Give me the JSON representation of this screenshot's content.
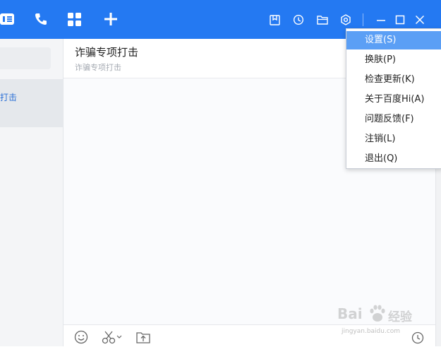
{
  "colors": {
    "accent": "#2479f2",
    "menu_highlight": "#5b9ff5",
    "link": "#2a6fd6"
  },
  "topbar": {
    "left_icons": [
      "contacts-icon",
      "phone-icon",
      "apps-grid-icon",
      "plus-icon"
    ],
    "right_icons": [
      "notes-icon",
      "history-icon",
      "folder-icon",
      "settings-hex-icon"
    ],
    "window_controls": [
      "minimize-icon",
      "maximize-icon",
      "close-icon"
    ]
  },
  "sidebar": {
    "selected_item_label": "打击"
  },
  "chat": {
    "title": "诈骗专项打击",
    "subtitle": "诈骗专项打击"
  },
  "menu": {
    "items": [
      {
        "label": "设置(S)",
        "highlighted": true
      },
      {
        "label": "换肤(P)",
        "highlighted": false
      },
      {
        "label": "检查更新(K)",
        "highlighted": false
      },
      {
        "label": "关于百度Hi(A)",
        "highlighted": false
      },
      {
        "label": "问题反馈(F)",
        "highlighted": false
      },
      {
        "label": "注销(L)",
        "highlighted": false
      },
      {
        "label": "退出(Q)",
        "highlighted": false
      }
    ]
  },
  "toolbar": {
    "icons": [
      "emoji-icon",
      "scissors-icon",
      "upload-folder-icon",
      "history-clock-icon"
    ]
  },
  "watermark": {
    "text": "Bai",
    "text2": "经验",
    "url": "jingyan.baidu.com"
  }
}
